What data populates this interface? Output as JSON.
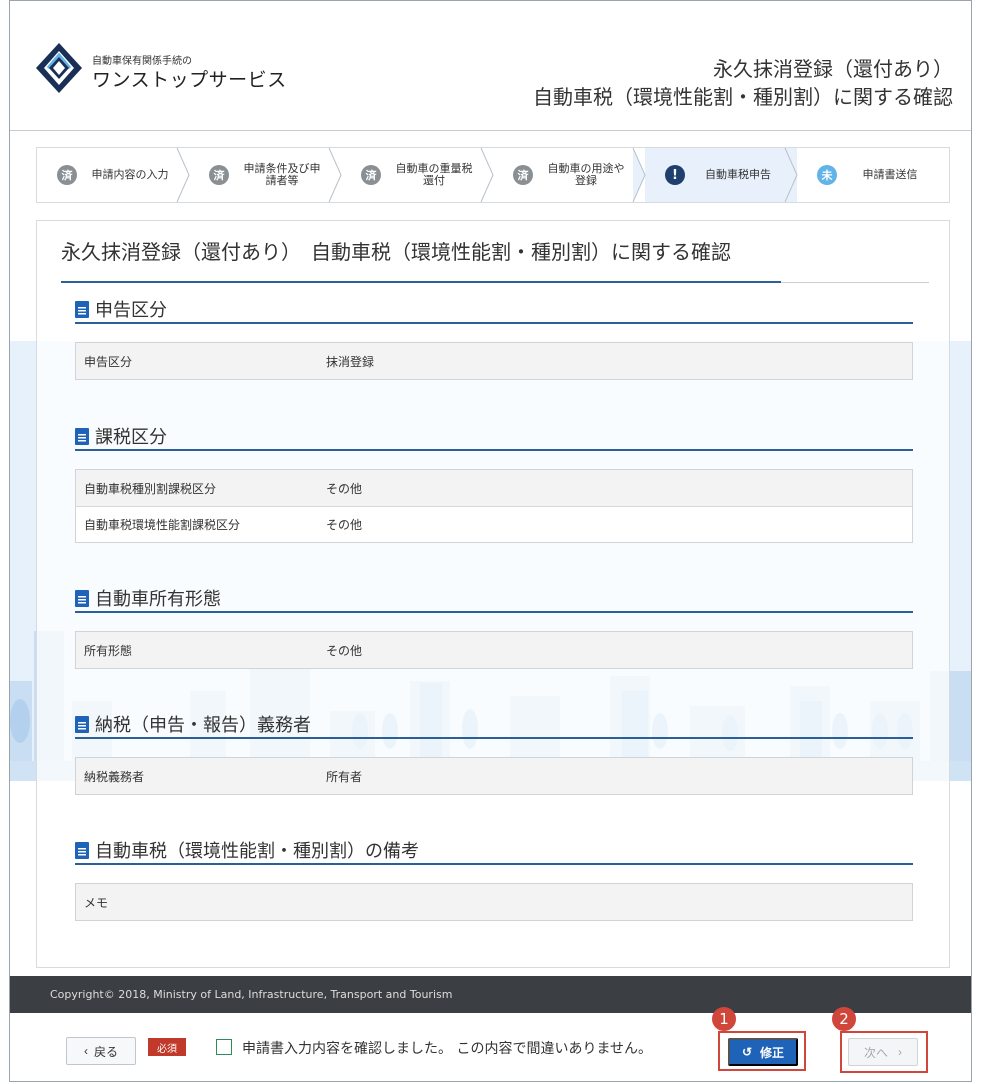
{
  "header": {
    "brand_small": "自動車保有関係手続の",
    "brand_big": "ワンストップサービス",
    "title_line1": "永久抹消登録（還付あり）",
    "title_line2": "自動車税（環境性能割・種別割）に関する確認"
  },
  "steps": [
    {
      "badge": "済",
      "label": "申請内容の入力",
      "state": "done"
    },
    {
      "badge": "済",
      "label": "申請条件及び申請者等",
      "state": "done"
    },
    {
      "badge": "済",
      "label": "自動車の重量税還付",
      "state": "done"
    },
    {
      "badge": "済",
      "label": "自動車の用途や登録",
      "state": "done"
    },
    {
      "badge": "!",
      "label": "自動車税申告",
      "state": "current"
    },
    {
      "badge": "未",
      "label": "申請書送信",
      "state": "todo"
    }
  ],
  "main": {
    "page_title": "永久抹消登録（還付あり）　自動車税（環境性能割・種別割）に関する確認",
    "sections": [
      {
        "title": "申告区分",
        "rows": [
          {
            "key": "申告区分",
            "value": "抹消登録"
          }
        ]
      },
      {
        "title": "課税区分",
        "rows": [
          {
            "key": "自動車税種別割課税区分",
            "value": "その他"
          },
          {
            "key": "自動車税環境性能割課税区分",
            "value": "その他"
          }
        ]
      },
      {
        "title": "自動車所有形態",
        "rows": [
          {
            "key": "所有形態",
            "value": "その他"
          }
        ]
      },
      {
        "title": "納税（申告・報告）義務者",
        "rows": [
          {
            "key": "納税義務者",
            "value": "所有者"
          }
        ]
      },
      {
        "title": "自動車税（環境性能割・種別割）の備考",
        "rows": [
          {
            "key": "メモ",
            "value": ""
          }
        ]
      }
    ]
  },
  "footer": {
    "copyright": "Copyright© 2018, Ministry of Land, Infrastructure, Transport and Tourism",
    "back_label": "戻る",
    "back_icon": "‹",
    "required_label": "必須",
    "confirm_text": "申請書入力内容を確認しました。 この内容で間違いありません。",
    "fix_label": "修正",
    "fix_icon": "↺",
    "next_label": "次へ",
    "next_icon": "›",
    "marker_1": "1",
    "marker_2": "2"
  },
  "colors": {
    "accent_blue": "#2a5f99",
    "primary_button": "#1e63b8",
    "required_red": "#c0392b",
    "annotation_red": "#d0463a",
    "footer_dark": "#3b3e43"
  }
}
